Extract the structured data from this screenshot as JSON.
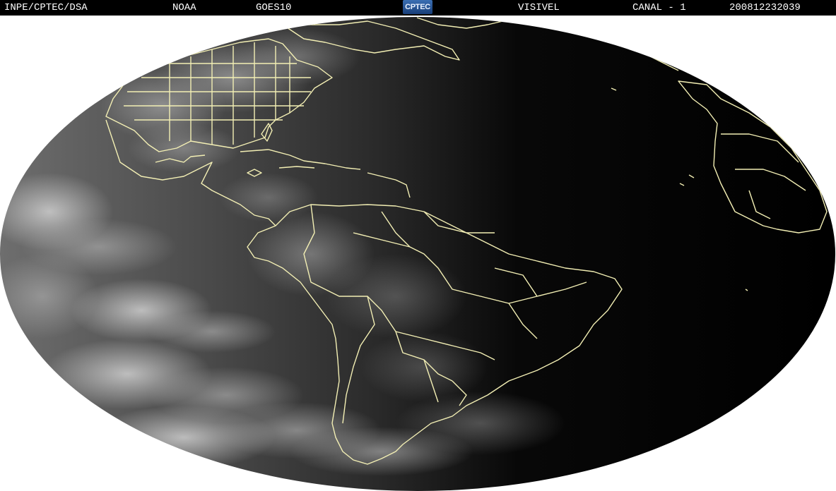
{
  "header": {
    "organization": "INPE/CPTEC/DSA",
    "agency": "NOAA",
    "satellite": "GOES10",
    "logo_text": "CPTEC",
    "band": "VISIVEL",
    "channel": "CANAL - 1",
    "timestamp": "200812232039"
  },
  "map": {
    "projection": "full-disk ellipse",
    "regions_shown": [
      "North America",
      "Central America",
      "Caribbean",
      "South America",
      "Atlantic Ocean",
      "West Africa",
      "Pacific Ocean"
    ],
    "colors": {
      "background": "#ffffff",
      "space": "#ffffff",
      "night_side": "#000000",
      "day_side_clouds": "#9a9a9a",
      "borders": "#f3efb4"
    }
  }
}
